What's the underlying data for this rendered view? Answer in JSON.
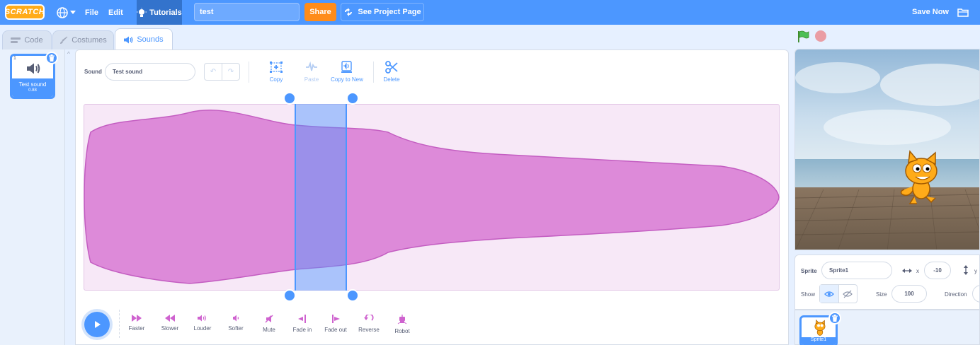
{
  "menubar": {
    "logo": "SCRATCH",
    "file": "File",
    "edit": "Edit",
    "tutorials": "Tutorials",
    "project_title": "test",
    "share": "Share",
    "see_project_page": "See Project Page",
    "save_now": "Save Now"
  },
  "tabs": [
    {
      "label": "Code",
      "icon": "code-icon"
    },
    {
      "label": "Costumes",
      "icon": "brush-icon"
    },
    {
      "label": "Sounds",
      "icon": "speaker-icon",
      "active": true
    }
  ],
  "sound_list": {
    "items": [
      {
        "index": "1",
        "name": "Test sound",
        "duration": "0.88"
      }
    ]
  },
  "editor": {
    "sound_label": "Sound",
    "sound_name": "Test sound",
    "tools": {
      "copy": "Copy",
      "paste": "Paste",
      "copy_to_new": "Copy to New",
      "delete": "Delete"
    },
    "effects": [
      "Faster",
      "Slower",
      "Louder",
      "Softer",
      "Mute",
      "Fade in",
      "Fade out",
      "Reverse",
      "Robot"
    ]
  },
  "sprite_info": {
    "sprite_label": "Sprite",
    "sprite_name": "Sprite1",
    "x_label": "x",
    "x_value": "-10",
    "y_label": "y",
    "show_label": "Show",
    "size_label": "Size",
    "size_value": "100",
    "direction_label": "Direction"
  },
  "sprites": [
    {
      "name": "Sprite1"
    }
  ],
  "colors": {
    "accent": "#4c97ff",
    "sound_pink": "#cf63cf",
    "share_orange": "#ff8c1a"
  }
}
